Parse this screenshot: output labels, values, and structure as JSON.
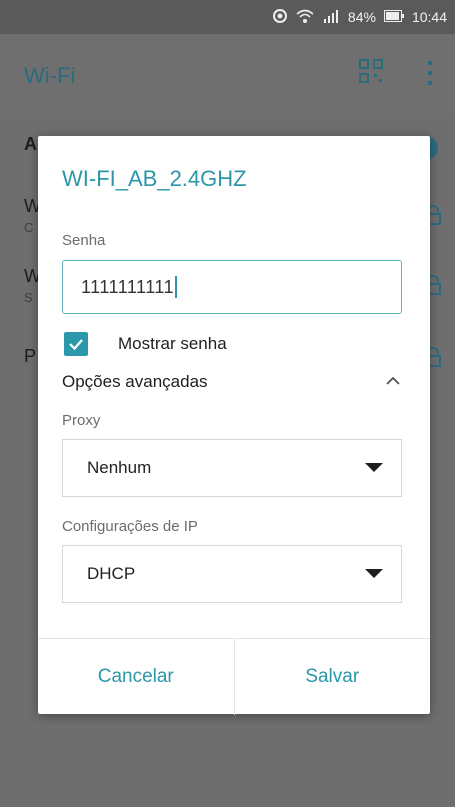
{
  "status_bar": {
    "battery": "84%",
    "time": "10:44"
  },
  "app_bar": {
    "title": "Wi-Fi"
  },
  "dialog": {
    "network_name": "WI-FI_AB_2.4GHZ",
    "password_label": "Senha",
    "password_value": "1111111111",
    "show_password_label": "Mostrar senha",
    "show_password_checked": true,
    "advanced_label": "Opções avançadas",
    "proxy_label": "Proxy",
    "proxy_value": "Nenhum",
    "ip_label": "Configurações de IP",
    "ip_value": "DHCP",
    "cancel_label": "Cancelar",
    "save_label": "Salvar"
  },
  "background": {
    "item1_title": "A",
    "item2_title": "W",
    "item2_sub": "C",
    "item3_title": "W",
    "item3_sub": "S",
    "item4_title": "P"
  },
  "colors": {
    "accent": "#2b97a8",
    "scrim": "#6e6e6e"
  }
}
